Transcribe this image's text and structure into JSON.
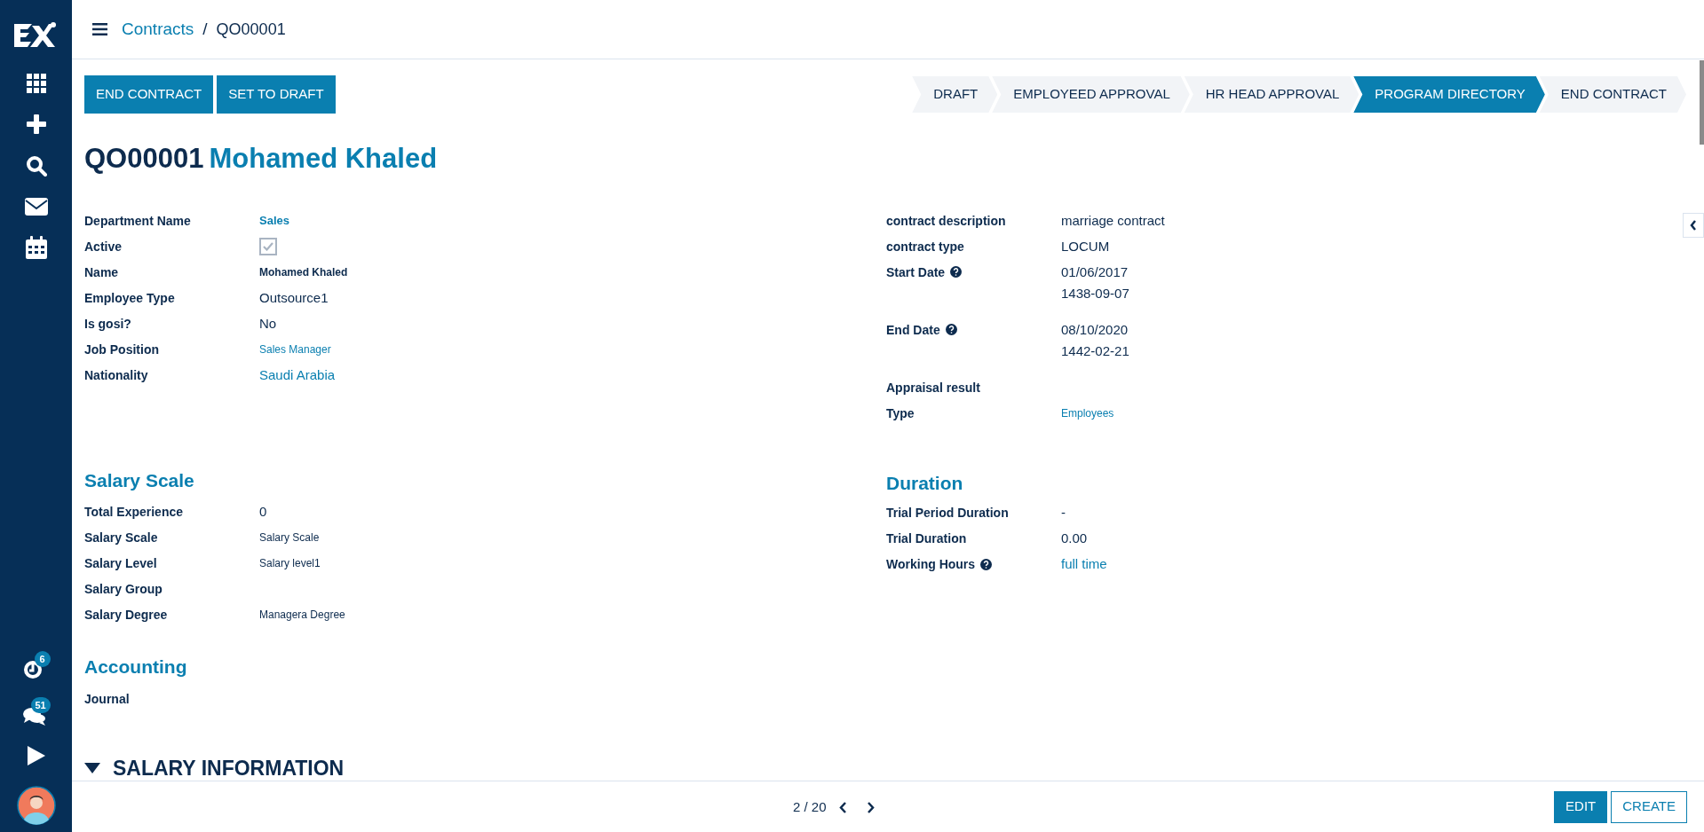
{
  "sidebar": {
    "badges": [
      "6",
      "51"
    ]
  },
  "breadcrumb": {
    "parent": "Contracts",
    "separator": "/",
    "current": "QO00001"
  },
  "actions": [
    "END CONTRACT",
    "SET TO DRAFT"
  ],
  "stages": [
    {
      "label": "DRAFT",
      "selected": false
    },
    {
      "label": "EMPLOYEED APPROVAL",
      "selected": false
    },
    {
      "label": "HR HEAD APPROVAL",
      "selected": false
    },
    {
      "label": "PROGRAM DIRECTORY",
      "selected": true
    },
    {
      "label": "END CONTRACT",
      "selected": false
    }
  ],
  "title": {
    "reference": "QO00001",
    "name": "Mohamed Khaled"
  },
  "left_fields": [
    {
      "label": "Department Name",
      "kind": "link-bold",
      "value": [
        "Sales"
      ]
    },
    {
      "label": "Active",
      "kind": "checkbox",
      "checked": true
    },
    {
      "label": "Name",
      "kind": "bold",
      "value": [
        "Mohamed Khaled"
      ]
    },
    {
      "label": "Employee Type",
      "kind": "text",
      "value": [
        "Outsource1"
      ]
    },
    {
      "label": "Is gosi?",
      "kind": "text",
      "value": [
        "No"
      ]
    },
    {
      "label": "Job Position",
      "kind": "link-small",
      "value": [
        "Sales Manager"
      ]
    },
    {
      "label": "Nationality",
      "kind": "link",
      "value": [
        "Saudi Arabia"
      ]
    }
  ],
  "right_fields": [
    {
      "label": "contract description",
      "kind": "text",
      "value": [
        "marriage contract"
      ]
    },
    {
      "label": "contract type",
      "kind": "text",
      "value": [
        "LOCUM"
      ]
    },
    {
      "label": "Start Date",
      "help": true,
      "kind": "text",
      "value": [
        "01/06/2017",
        "1438-09-07"
      ]
    },
    {
      "label": "End Date",
      "help": true,
      "kind": "text",
      "value": [
        "08/10/2020",
        "1442-02-21"
      ]
    },
    {
      "label": "Appraisal result"
    },
    {
      "label": "Type",
      "kind": "link-small",
      "value": [
        "Employees"
      ]
    }
  ],
  "salary_scale": {
    "heading": "Salary Scale",
    "fields": [
      {
        "label": "Total Experience",
        "kind": "text",
        "value": [
          "0"
        ]
      },
      {
        "label": "Salary Scale",
        "kind": "small",
        "value": [
          "Salary Scale"
        ]
      },
      {
        "label": "Salary Level",
        "kind": "small",
        "value": [
          "Salary level1"
        ]
      },
      {
        "label": "Salary Group"
      },
      {
        "label": "Salary Degree",
        "kind": "small",
        "value": [
          "Managera Degree"
        ]
      }
    ]
  },
  "duration": {
    "heading": "Duration",
    "fields": [
      {
        "label": "Trial Period Duration",
        "kind": "text",
        "value": [
          "-"
        ]
      },
      {
        "label": "Trial Duration",
        "kind": "text",
        "value": [
          "0.00"
        ]
      },
      {
        "label": "Working Hours",
        "help": true,
        "kind": "link",
        "value": [
          "full time"
        ]
      }
    ]
  },
  "accounting": {
    "heading": "Accounting",
    "fields": [
      {
        "label": "Journal"
      }
    ]
  },
  "salary_information": {
    "heading": "SALARY INFORMATION",
    "expanded": true
  },
  "pager": {
    "text": "2 / 20"
  },
  "footer_buttons": [
    {
      "label": "EDIT",
      "kind": "primary"
    },
    {
      "label": "CREATE",
      "kind": "secondary"
    }
  ]
}
